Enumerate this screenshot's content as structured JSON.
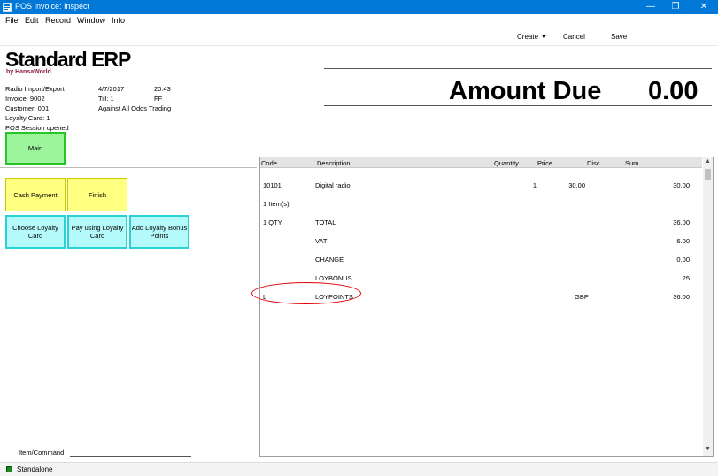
{
  "window": {
    "title": "POS Invoice: Inspect",
    "minimize": "—",
    "restore": "❐",
    "close": "✕"
  },
  "menu": [
    "File",
    "Edit",
    "Record",
    "Window",
    "Info"
  ],
  "toolbar": {
    "create_label": "Create",
    "cancel_label": "Cancel",
    "save_label": "Save"
  },
  "logo": {
    "main": "Standard ERP",
    "sub": "by HansaWorld"
  },
  "info": {
    "company": "Radio Import/Export",
    "date": "4/7/2017",
    "time": "20:43",
    "invoice": "Invoice: 9002",
    "till": "Till: 1",
    "till_code": "FF",
    "customer": "Customer: 001",
    "customer_name": "Against All Odds Trading",
    "loyalty_card": "Loyalty Card: 1",
    "session": "POS Session opened"
  },
  "amount": {
    "label": "Amount Due",
    "value": "0.00"
  },
  "buttons": {
    "main": "Main",
    "cash_payment": "Cash Payment",
    "finish": "Finish",
    "choose_loyalty_card": "Choose Loyalty Card",
    "pay_using_loyalty_card": "Pay using Loyalty Card",
    "add_loyalty_bonus_points": "Add Loyalty Bonus Points"
  },
  "grid": {
    "headers": {
      "code": "Code",
      "description": "Description",
      "quantity": "Quantity",
      "price": "Price",
      "disc": "Disc.",
      "sum": "Sum"
    },
    "rows": [
      {
        "code": "10101",
        "description": "Digital radio",
        "quantity": "1",
        "price": "30.00",
        "disc": "",
        "sum": "30.00"
      },
      {
        "code": "1 Item(s)",
        "description": "",
        "quantity": "",
        "price": "",
        "disc": "",
        "sum": ""
      },
      {
        "code": "1 QTY",
        "description": "TOTAL",
        "quantity": "",
        "price": "",
        "disc": "",
        "sum": "36.00"
      },
      {
        "code": "",
        "description": "VAT",
        "quantity": "",
        "price": "",
        "disc": "",
        "sum": "6.00"
      },
      {
        "code": "",
        "description": "CHANGE",
        "quantity": "",
        "price": "",
        "disc": "",
        "sum": "0.00"
      },
      {
        "code": "",
        "description": "LOYBONUS",
        "quantity": "",
        "price": "",
        "disc": "",
        "sum": "25"
      },
      {
        "code": "L",
        "description": "LOYPOINTS",
        "quantity": "",
        "price": "GBP",
        "disc": "",
        "sum": "36.00"
      }
    ]
  },
  "command": {
    "label": "Item/Command",
    "value": ""
  },
  "status": {
    "text": "Standalone",
    "indicator_color": "#1a8a1a"
  },
  "colors": {
    "titlebar": "#0078d7",
    "main_button": "#9cf59c",
    "yellow_button": "#ffff80",
    "cyan_button": "#b4fafa",
    "highlight": "#e00000"
  }
}
